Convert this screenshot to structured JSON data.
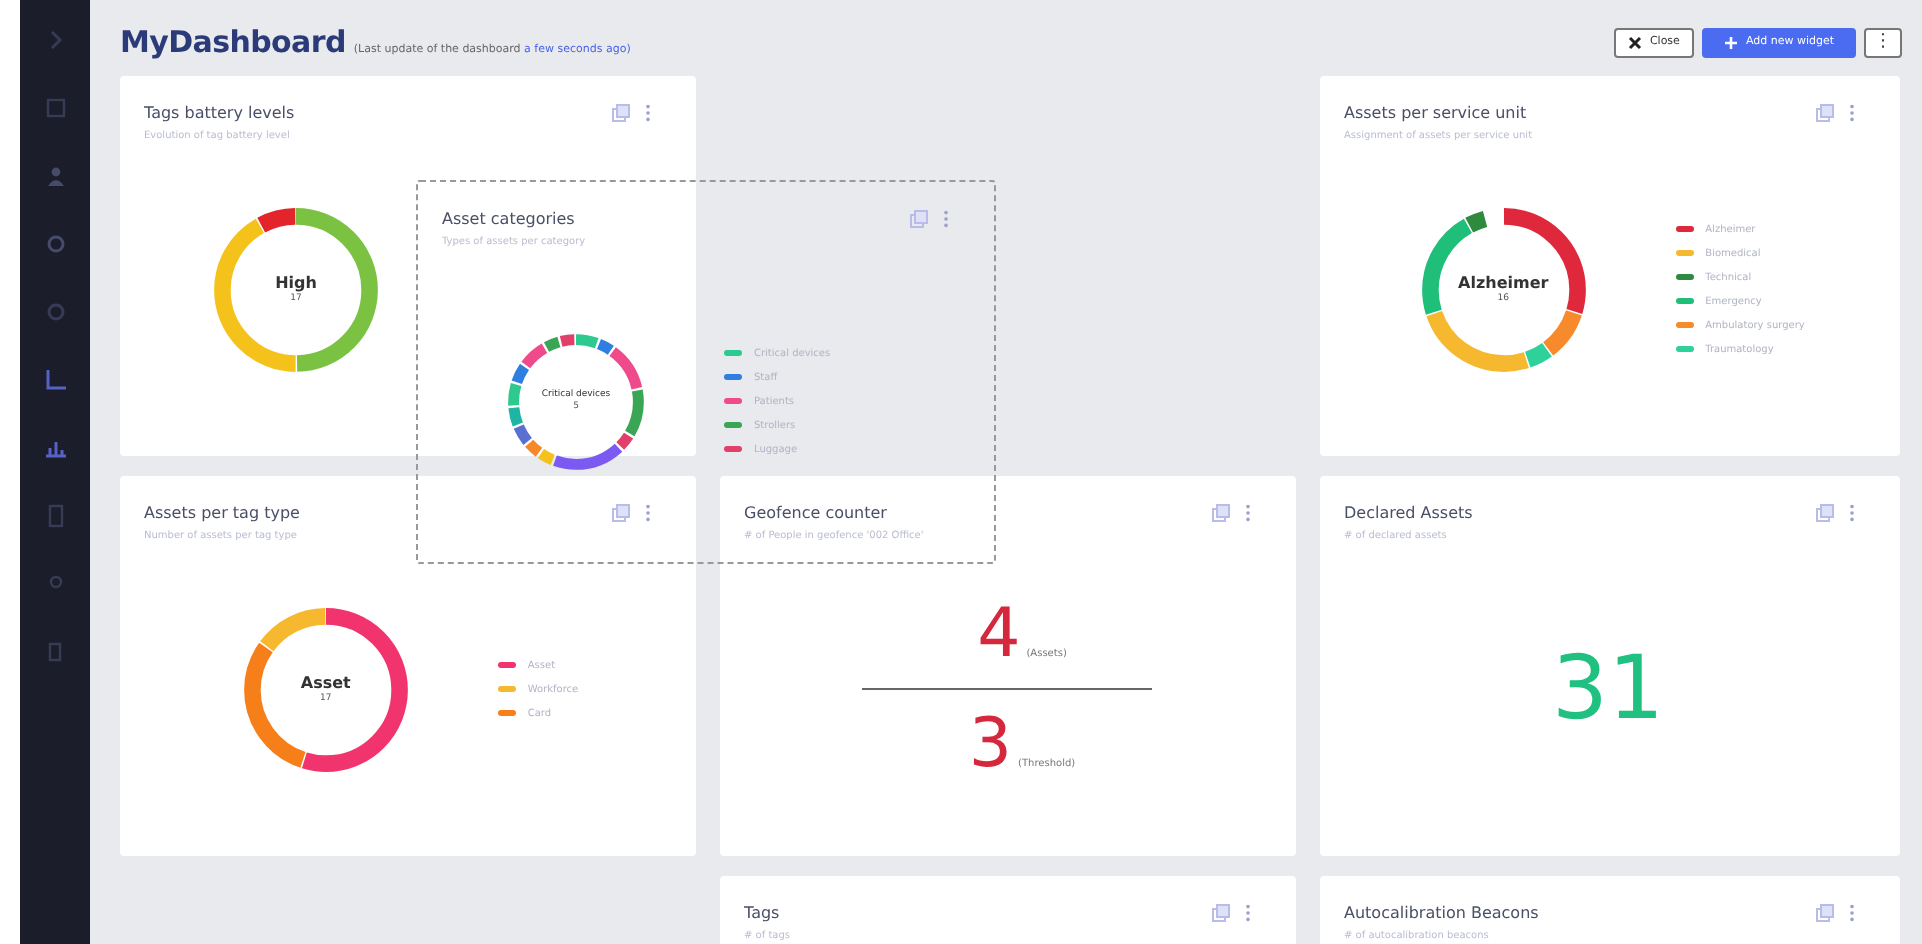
{
  "header": {
    "title": "MyDashboard",
    "subtitle": "(Last update of the dashboard ",
    "link": "a few seconds ago)"
  },
  "actions": [
    {
      "kind": "close",
      "label": "Close"
    },
    {
      "kind": "add",
      "label": "Add new widget"
    },
    {
      "kind": "more",
      "label": "⋮"
    }
  ],
  "widgets": [
    {
      "kind": "donut",
      "title": "Tags battery levels",
      "subtitle": "Evolution of tag battery level",
      "center": "High",
      "center_value": "17"
    },
    {
      "kind": "donut",
      "title": "Assets per service unit",
      "subtitle": "Assignment of assets per service unit",
      "center": "Alzheimer",
      "center_value": "16",
      "legend": [
        {
          "label": "Alzheimer",
          "color": "#e0283c"
        },
        {
          "label": "Biomedical",
          "color": "#f5b82e"
        },
        {
          "label": "Technical",
          "color": "#2e8b3e"
        },
        {
          "label": "Emergency",
          "color": "#1fbf7a"
        },
        {
          "label": "Ambulatory surgery",
          "color": "#f78a2a"
        },
        {
          "label": "Traumatology",
          "color": "#2ed19a"
        }
      ]
    },
    {
      "kind": "donut",
      "title": "Assets per tag type",
      "subtitle": "Number of assets per tag type",
      "center": "Asset",
      "center_value": "17",
      "legend": [
        {
          "label": "Asset",
          "color": "#f2346e"
        },
        {
          "label": "Workforce",
          "color": "#f5b82e"
        },
        {
          "label": "Card",
          "color": "#f77f1a"
        }
      ]
    },
    {
      "kind": "counter",
      "title": "Geofence counter",
      "subtitle": "# of People in geofence '002 Office'",
      "value": "4",
      "value_label": "(Assets)",
      "threshold": "3",
      "threshold_label": "(Threshold)"
    },
    {
      "kind": "number",
      "title": "Declared Assets",
      "subtitle": "# of declared assets",
      "value": "31"
    },
    {
      "kind": "plain",
      "title": "Tags",
      "subtitle": "# of tags"
    },
    {
      "kind": "plain",
      "title": "Autocalibration Beacons",
      "subtitle": "# of autocalibration beacons"
    }
  ],
  "dragged_widget": {
    "title": "Asset categories",
    "subtitle": "Types of assets per category",
    "center": "Critical devices",
    "center_value": "5",
    "legend": [
      {
        "label": "Critical devices",
        "color": "#2ec98e"
      },
      {
        "label": "Staff",
        "color": "#2f7fe0"
      },
      {
        "label": "Patients",
        "color": "#ef4a8c"
      },
      {
        "label": "Strollers",
        "color": "#3aa655"
      },
      {
        "label": "Luggage",
        "color": "#e0406a"
      }
    ]
  }
}
